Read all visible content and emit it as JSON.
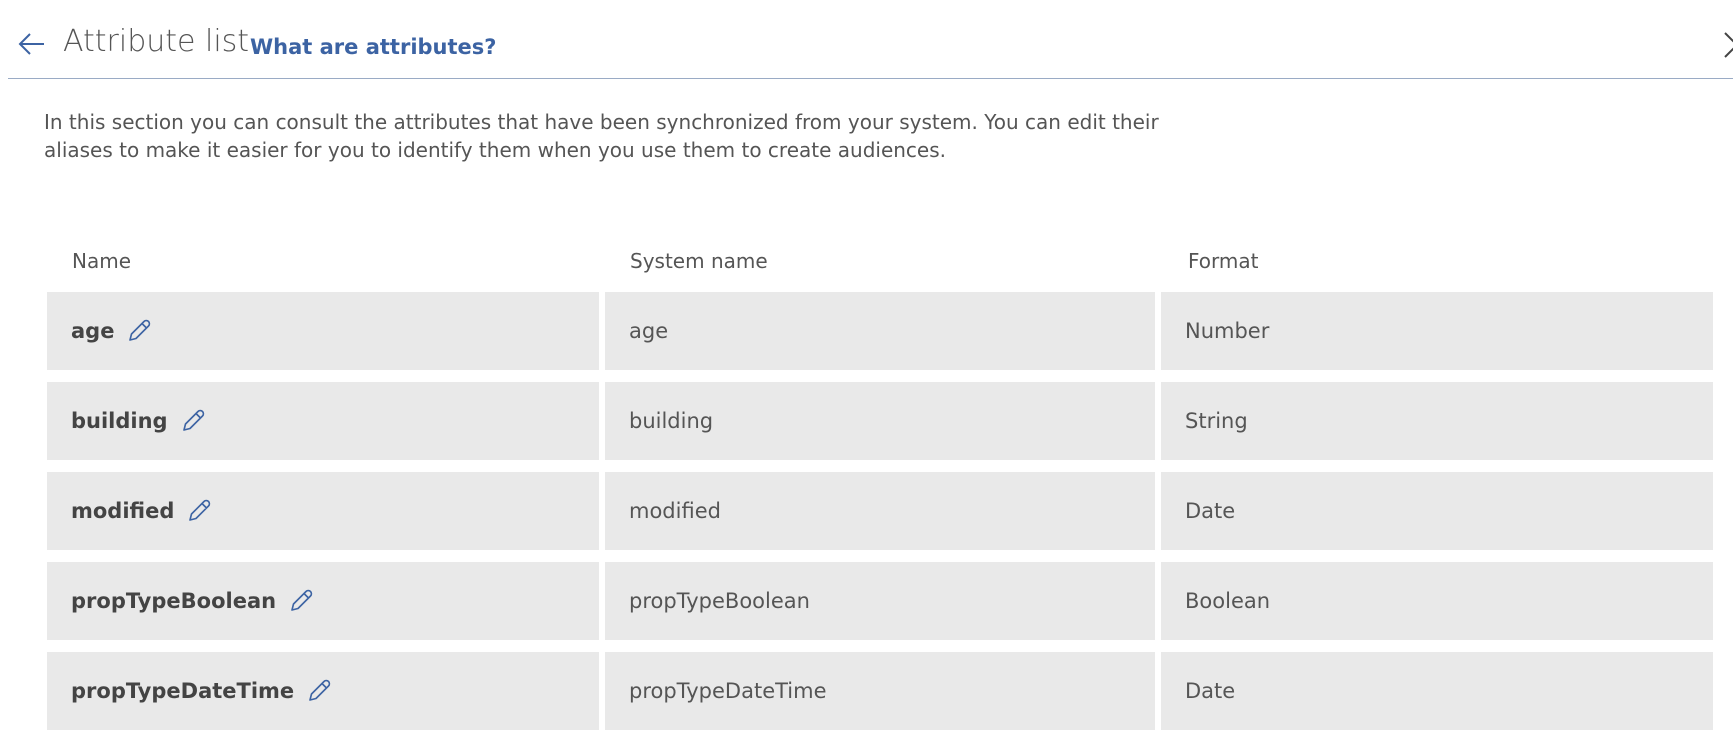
{
  "header": {
    "title": "Attribute list",
    "help_link": "What are attributes?",
    "back_icon": "arrow-left-icon",
    "close_icon": "close-icon"
  },
  "intro": {
    "text": "In this section you can consult the attributes that have been synchronized from your system. You can edit their aliases to make it easier for you to identify them when you use them to create audiences."
  },
  "table": {
    "columns": [
      "Name",
      "System name",
      "Format"
    ],
    "rows": [
      {
        "name": "age",
        "system_name": "age",
        "format": "Number"
      },
      {
        "name": "building",
        "system_name": "building",
        "format": "String"
      },
      {
        "name": "modified",
        "system_name": "modified",
        "format": "Date"
      },
      {
        "name": "propTypeBoolean",
        "system_name": "propTypeBoolean",
        "format": "Boolean"
      },
      {
        "name": "propTypeDateTime",
        "system_name": "propTypeDateTime",
        "format": "Date"
      }
    ],
    "edit_icon": "pencil-icon"
  },
  "colors": {
    "accent": "#3c63a3",
    "row_background": "#e9e9e9",
    "text": "#555555"
  }
}
